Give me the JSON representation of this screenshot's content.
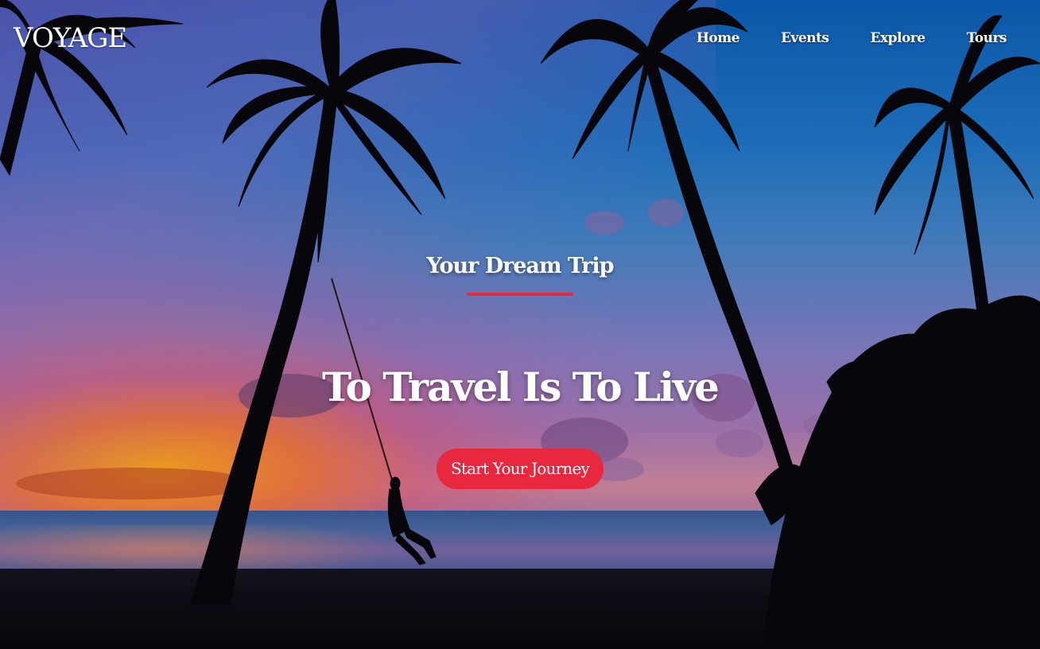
{
  "brand": {
    "logo": "VOYAGE"
  },
  "nav": {
    "items": [
      {
        "label": "Home"
      },
      {
        "label": "Events"
      },
      {
        "label": "Explore"
      },
      {
        "label": "Tours"
      }
    ]
  },
  "hero": {
    "subtitle": "Your Dream Trip",
    "headline": "To Travel Is To Live",
    "cta_label": "Start Your Journey",
    "accent_color": "#e8283e",
    "background_image": "tropical-sunset-beach-palm-trees-swing"
  }
}
